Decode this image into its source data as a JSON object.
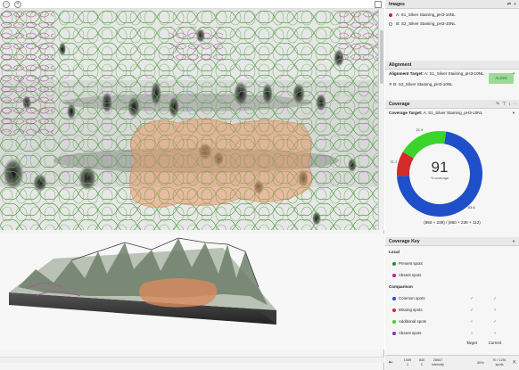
{
  "left": {
    "topbar": {
      "minus": "−",
      "add": "+"
    }
  },
  "images": {
    "header": "Images",
    "items": [
      {
        "label": "A: S1_Silver Staining_pH3-10NL",
        "color": "#cc2222"
      },
      {
        "label": "B: S2_Silver Staining_pH3-10NL",
        "color": "#ffffff"
      }
    ]
  },
  "alignment": {
    "header": "Alignment",
    "target_label": "Alignment Target:",
    "target_value": "A: S1_Silver Staining_pH3-10NL",
    "item": "B: S2_Silver Staining_pH3-10NL",
    "align_button": "ALIGN"
  },
  "coverage": {
    "header": "Coverage",
    "target_label": "Coverage Target:",
    "target_value": "A: S1_Silver Staining_pH3-10NL",
    "center_value": "91",
    "center_sub": "% coverage",
    "formula": "(850 + 239) / (850 + 239 + 112)",
    "chart_data": {
      "type": "pie",
      "categories": [
        "Common",
        "Missing",
        "Additional"
      ],
      "values": [
        83.6,
        11.1,
        21.9
      ],
      "labels": [
        "83.6",
        "11.1",
        "21.9"
      ],
      "colors": [
        "#1f4fc9",
        "#d42a2a",
        "#3bd42b"
      ]
    }
  },
  "key": {
    "header": "Coverage Key",
    "local_title": "Local",
    "local": [
      {
        "label": "Present spots",
        "color": "#2e8b2e"
      },
      {
        "label": "Absent spots",
        "color": "#c2189b"
      }
    ],
    "comparison_title": "Comparison",
    "comparison": [
      {
        "label": "Common spots",
        "color": "#1f4fc9",
        "target": "✓",
        "current": "✓"
      },
      {
        "label": "Missing spots",
        "color": "#d42a2a",
        "target": "✓",
        "current": "×"
      },
      {
        "label": "Additional spots",
        "color": "#3bd42b",
        "target": "×",
        "current": "✓"
      },
      {
        "label": "Absent spots",
        "color": "#7a3bb5",
        "target": "×",
        "current": "×"
      }
    ],
    "col_target": "Target",
    "col_current": "Current"
  },
  "status": {
    "s1_value": "1089",
    "s1_label": "1",
    "s2_value": "840",
    "s2_label": "2",
    "s3_value": "28547",
    "s3_label": "intensity",
    "zoom": "30%",
    "counter": "70 / 1201",
    "counter_label": "spots"
  }
}
